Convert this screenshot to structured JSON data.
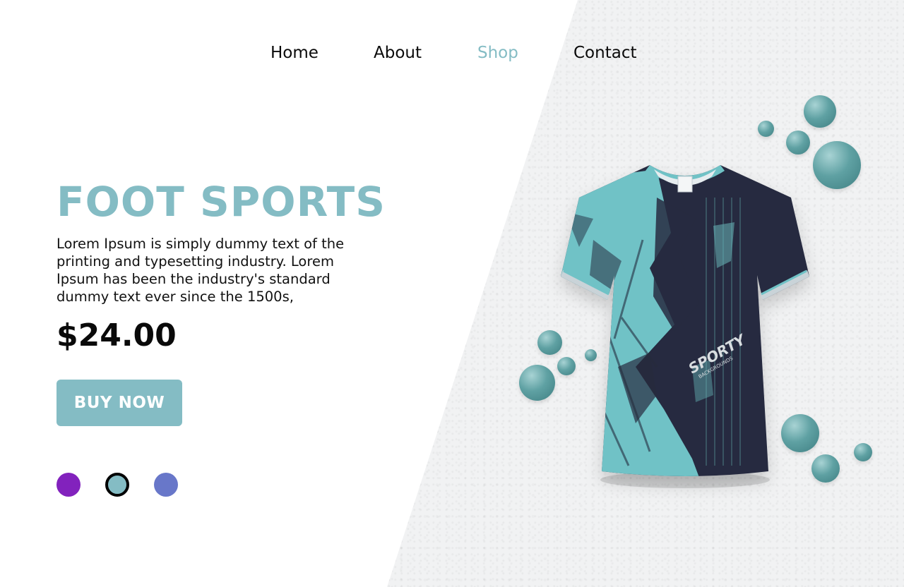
{
  "nav": {
    "items": [
      {
        "label": "Home",
        "active": false
      },
      {
        "label": "About",
        "active": false
      },
      {
        "label": "Shop",
        "active": true
      },
      {
        "label": "Contact",
        "active": false
      }
    ]
  },
  "hero": {
    "title": "FOOT SPORTS",
    "description": "Lorem Ipsum is simply dummy text of the printing and typesetting industry. Lorem Ipsum has been the industry's standard dummy text ever since the 1500s,",
    "price": "$24.00",
    "buy_label": "BUY NOW"
  },
  "product": {
    "print_text": "SPORTY",
    "print_subtext": "BACKGROUNDS"
  },
  "colors": {
    "accent": "#84bcc4",
    "text": "#0a0a0a",
    "swatches": [
      "#8222bd",
      "#84bcc4",
      "#6877c9"
    ],
    "selected_swatch": 1,
    "shirt_navy": "#262c3f",
    "shirt_teal": "#6fc2c6"
  }
}
